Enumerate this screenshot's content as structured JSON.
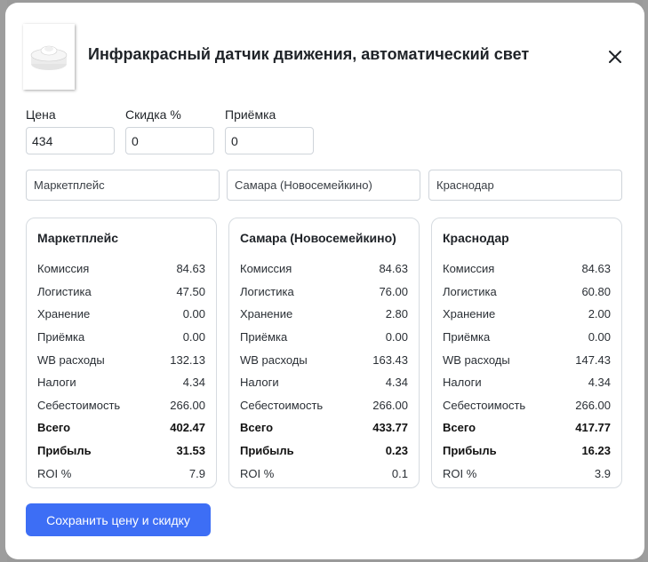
{
  "product": {
    "title": "Инфракрасный датчик движения, автоматический свет"
  },
  "pricing": {
    "price_label": "Цена",
    "price_value": "434",
    "discount_label": "Скидка %",
    "discount_value": "0",
    "acceptance_label": "Приёмка",
    "acceptance_value": "0"
  },
  "warehouses": [
    "Маркетплейс",
    "Самара (Новосемейкино)",
    "Краснодар"
  ],
  "cards": [
    {
      "title": "Маркетплейс",
      "rows": [
        {
          "label": "Комиссия",
          "value": "84.63"
        },
        {
          "label": "Логистика",
          "value": "47.50"
        },
        {
          "label": "Хранение",
          "value": "0.00"
        },
        {
          "label": "Приёмка",
          "value": "0.00"
        },
        {
          "label": "WB расходы",
          "value": "132.13"
        },
        {
          "label": "Налоги",
          "value": "4.34"
        },
        {
          "label": "Себестоимость",
          "value": "266.00"
        },
        {
          "label": "Всего",
          "value": "402.47"
        },
        {
          "label": "Прибыль",
          "value": "31.53"
        },
        {
          "label": "ROI %",
          "value": "7.9"
        }
      ]
    },
    {
      "title": "Самара (Новосемейкино)",
      "rows": [
        {
          "label": "Комиссия",
          "value": "84.63"
        },
        {
          "label": "Логистика",
          "value": "76.00"
        },
        {
          "label": "Хранение",
          "value": "2.80"
        },
        {
          "label": "Приёмка",
          "value": "0.00"
        },
        {
          "label": "WB расходы",
          "value": "163.43"
        },
        {
          "label": "Налоги",
          "value": "4.34"
        },
        {
          "label": "Себестоимость",
          "value": "266.00"
        },
        {
          "label": "Всего",
          "value": "433.77"
        },
        {
          "label": "Прибыль",
          "value": "0.23"
        },
        {
          "label": "ROI %",
          "value": "0.1"
        }
      ]
    },
    {
      "title": "Краснодар",
      "rows": [
        {
          "label": "Комиссия",
          "value": "84.63"
        },
        {
          "label": "Логистика",
          "value": "60.80"
        },
        {
          "label": "Хранение",
          "value": "2.00"
        },
        {
          "label": "Приёмка",
          "value": "0.00"
        },
        {
          "label": "WB расходы",
          "value": "147.43"
        },
        {
          "label": "Налоги",
          "value": "4.34"
        },
        {
          "label": "Себестоимость",
          "value": "266.00"
        },
        {
          "label": "Всего",
          "value": "417.77"
        },
        {
          "label": "Прибыль",
          "value": "16.23"
        },
        {
          "label": "ROI %",
          "value": "3.9"
        }
      ]
    }
  ],
  "save_button_label": "Сохранить цену и скидку",
  "colors": {
    "accent": "#3d6ef5"
  }
}
